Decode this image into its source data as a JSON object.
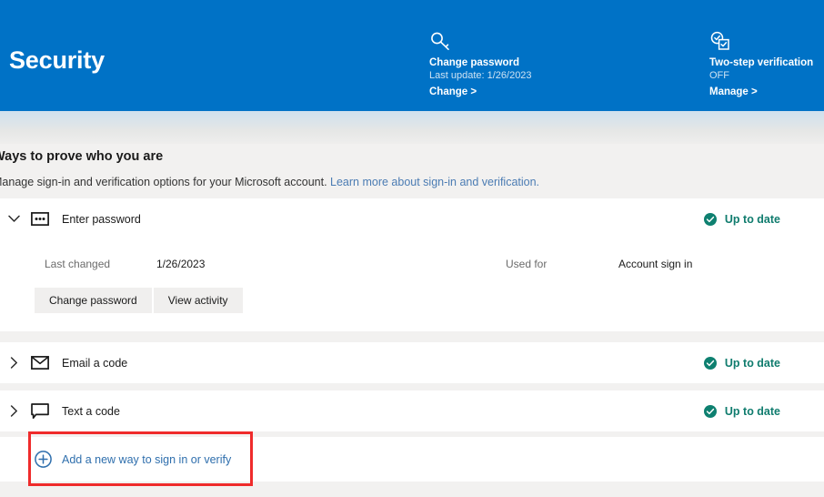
{
  "header": {
    "title": "Security",
    "accent_color": "#0072c6",
    "tiles": [
      {
        "icon": "key-icon",
        "title": "Change password",
        "subtitle": "Last update: 1/26/2023",
        "action": "Change >"
      },
      {
        "icon": "two-step-verification-icon",
        "title": "Two-step verification",
        "subtitle": "OFF",
        "action": "Manage >"
      }
    ]
  },
  "section": {
    "title": "Ways to prove who you are",
    "description": "Manage sign-in and verification options for your Microsoft account. ",
    "link_text": "Learn more about sign-in and verification.",
    "link_color": "#4b7cb3"
  },
  "methods": [
    {
      "id": "enter-password",
      "chevron": "chevron-down-icon",
      "icon": "password-field-icon",
      "label": "Enter password",
      "status": "Up to date",
      "status_icon": "check-circle-icon",
      "status_color": "#107c6e",
      "expanded": true,
      "details": {
        "label_left": "Last changed",
        "value_left": "1/26/2023",
        "label_right": "Used for",
        "value_right": "Account sign in",
        "buttons": [
          "Change password",
          "View activity"
        ]
      }
    },
    {
      "id": "email-a-code",
      "chevron": "chevron-right-icon",
      "icon": "envelope-icon",
      "label": "Email a code",
      "status": "Up to date",
      "status_icon": "check-circle-icon",
      "status_color": "#107c6e",
      "expanded": false
    },
    {
      "id": "text-a-code",
      "chevron": "chevron-right-icon",
      "icon": "speech-bubble-icon",
      "label": "Text a code",
      "status": "Up to date",
      "status_icon": "check-circle-icon",
      "status_color": "#107c6e",
      "expanded": false
    }
  ],
  "add_row": {
    "icon": "plus-circle-icon",
    "label": "Add a new way to sign in or verify",
    "link_color": "#2f6fad"
  },
  "annotation": {
    "type": "highlight-box",
    "color": "#ef2b2b",
    "target": "add-new-way-row"
  }
}
